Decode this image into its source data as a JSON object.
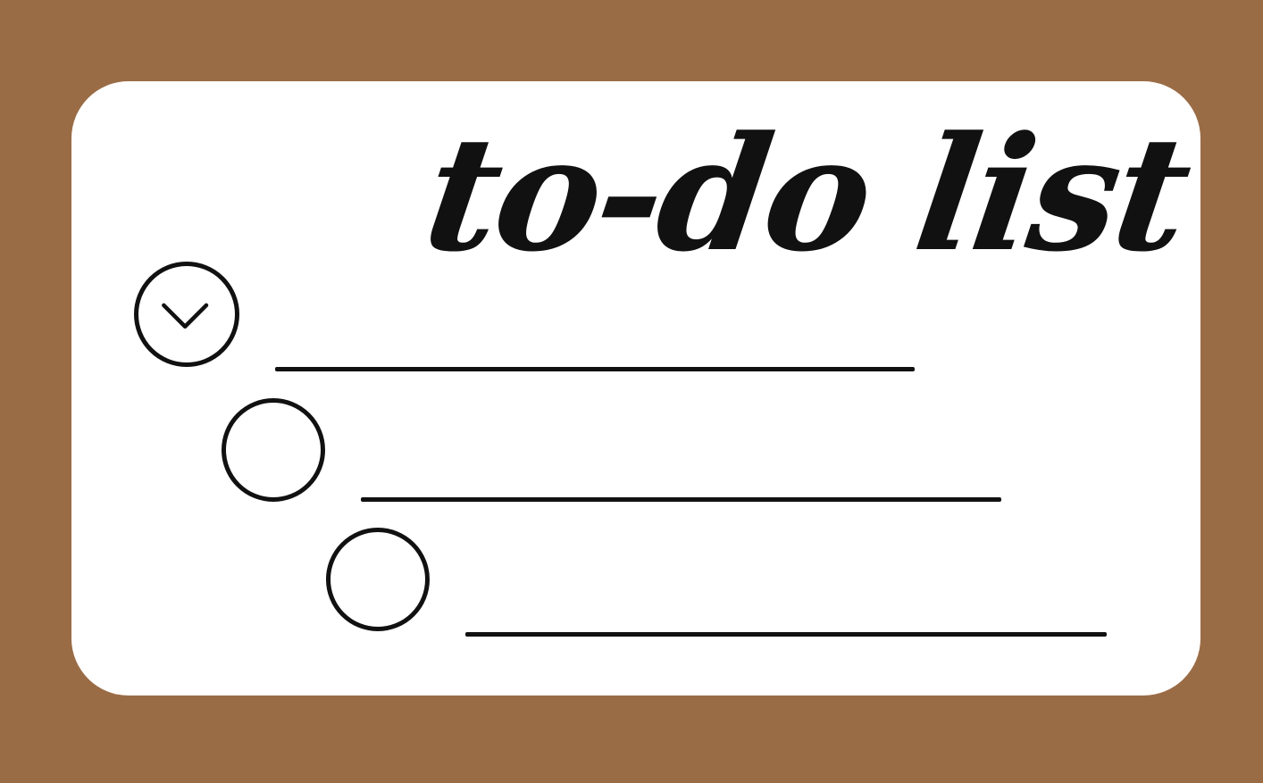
{
  "title": "to-do list",
  "colors": {
    "background": "#9a6c46",
    "card": "#ffffff",
    "ink": "#111111"
  },
  "tasks": [
    {
      "checked": true,
      "text": ""
    },
    {
      "checked": false,
      "text": ""
    },
    {
      "checked": false,
      "text": ""
    }
  ],
  "icons": {
    "checked": "chevron-down-icon",
    "unchecked": "empty-circle-icon"
  }
}
